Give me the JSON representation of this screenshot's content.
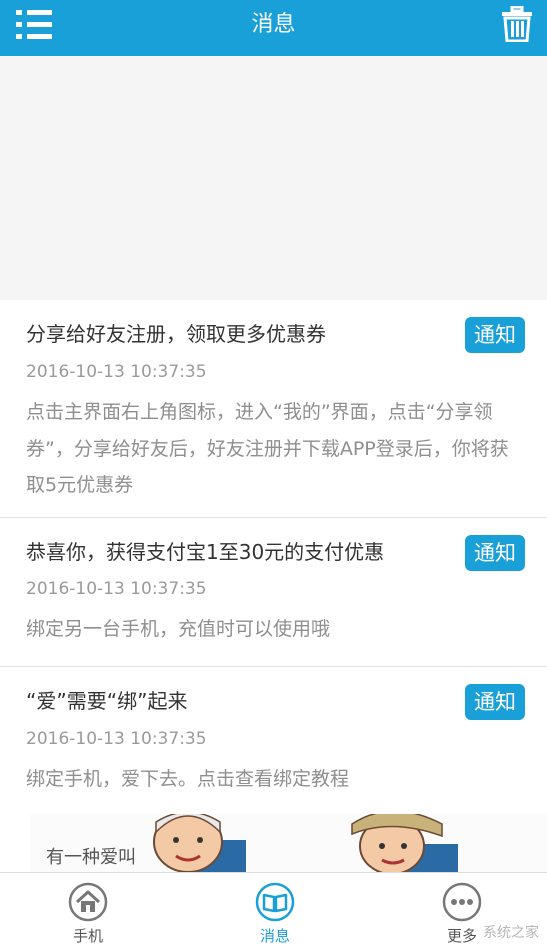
{
  "header": {
    "title": "消息"
  },
  "messages": [
    {
      "title": "分享给好友注册，领取更多优惠券",
      "tag": "通知",
      "time": "2016-10-13 10:37:35",
      "body": "点击主界面右上角图标，进入“我的”界面，点击“分享领券”，分享给好友后，好友注册并下载APP登录后，你将获取5元优惠券"
    },
    {
      "title": "恭喜你，获得支付宝1至30元的支付优惠",
      "tag": "通知",
      "time": "2016-10-13 10:37:35",
      "body": "绑定另一台手机，充值时可以使用哦"
    },
    {
      "title": "“爱”需要“绑”起来",
      "tag": "通知",
      "time": "2016-10-13 10:37:35",
      "body": "绑定手机，爱下去。点击查看绑定教程"
    }
  ],
  "illustration": {
    "text": "有一种爱叫"
  },
  "bottom_nav": {
    "items": [
      {
        "label": "手机",
        "icon": "home-icon",
        "active": false
      },
      {
        "label": "消息",
        "icon": "book-icon",
        "active": true
      },
      {
        "label": "更多",
        "icon": "more-icon",
        "active": false
      }
    ]
  },
  "watermark": "系统之家",
  "colors": {
    "accent": "#1aa0d8",
    "text": "#333333",
    "muted": "#9a9a9a"
  }
}
